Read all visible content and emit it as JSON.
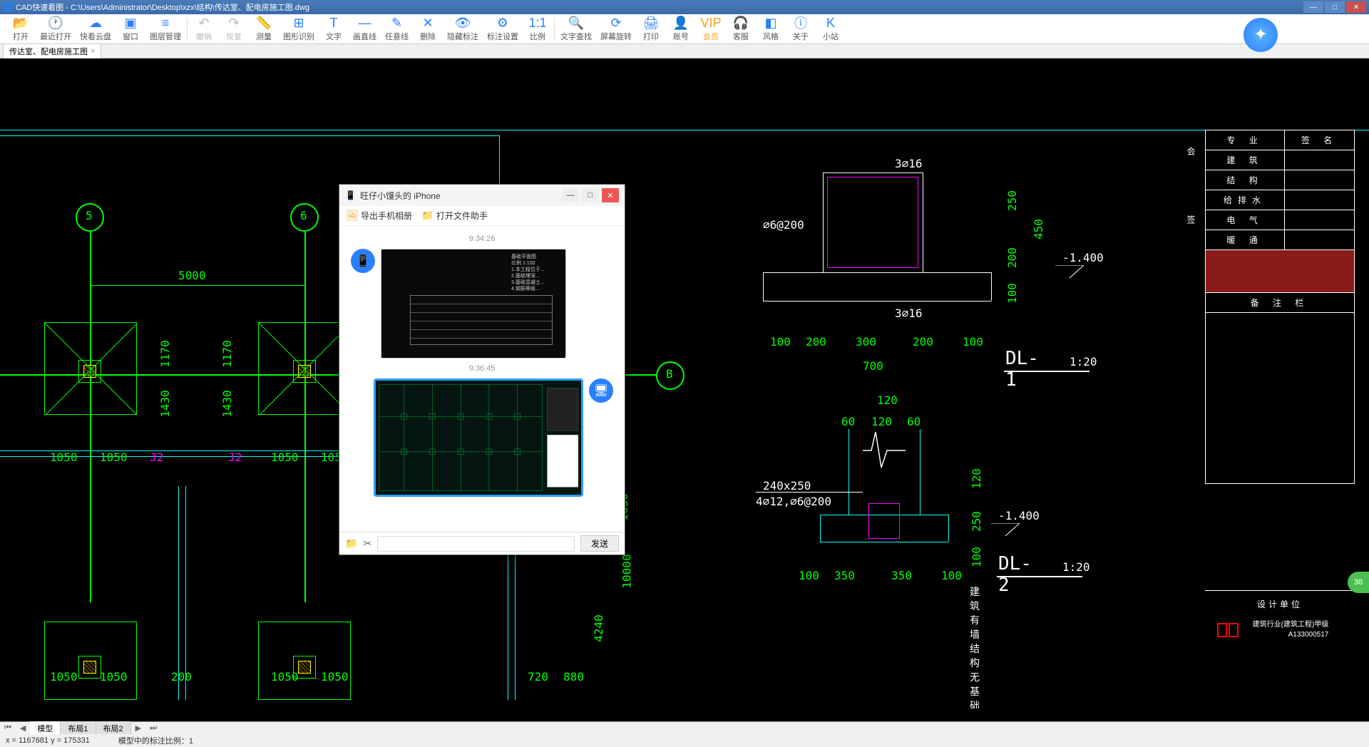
{
  "titlebar": {
    "app_name": "CAD快速看图",
    "file_path": "C:\\Users\\Administrator\\Desktop\\xzx\\结构\\传达室、配电房施工图.dwg"
  },
  "toolbar": [
    {
      "icon": "📂",
      "label": "打开",
      "name": "open-button"
    },
    {
      "icon": "🕐",
      "label": "最近打开",
      "name": "recent-button"
    },
    {
      "icon": "☁",
      "label": "快看云盘",
      "name": "cloud-button"
    },
    {
      "icon": "▣",
      "label": "窗口",
      "name": "window-button"
    },
    {
      "icon": "≡",
      "label": "图层管理",
      "name": "layer-button"
    },
    {
      "sep": true
    },
    {
      "icon": "↶",
      "label": "撤销",
      "name": "undo-button",
      "disabled": true
    },
    {
      "icon": "↷",
      "label": "恢复",
      "name": "redo-button",
      "disabled": true
    },
    {
      "icon": "📏",
      "label": "测量",
      "name": "measure-button"
    },
    {
      "icon": "⊞",
      "label": "图形识别",
      "name": "recognize-button"
    },
    {
      "icon": "T",
      "label": "文字",
      "name": "text-button"
    },
    {
      "icon": "—",
      "label": "画直线",
      "name": "line-button"
    },
    {
      "icon": "✎",
      "label": "任意线",
      "name": "freeline-button"
    },
    {
      "icon": "✕",
      "label": "删除",
      "name": "delete-button"
    },
    {
      "icon": "👁",
      "label": "隐藏标注",
      "name": "hide-annot-button"
    },
    {
      "icon": "⚙",
      "label": "标注设置",
      "name": "annot-settings-button"
    },
    {
      "icon": "1:1",
      "label": "比例",
      "name": "scale-button"
    },
    {
      "sep": true
    },
    {
      "icon": "🔍",
      "label": "文字查找",
      "name": "find-text-button"
    },
    {
      "icon": "⟳",
      "label": "屏幕旋转",
      "name": "rotate-button"
    },
    {
      "icon": "🖨",
      "label": "打印",
      "name": "print-button"
    },
    {
      "icon": "👤",
      "label": "账号",
      "name": "account-button"
    },
    {
      "icon": "VIP",
      "label": "会员",
      "name": "vip-button",
      "vip": true
    },
    {
      "icon": "🎧",
      "label": "客服",
      "name": "support-button"
    },
    {
      "icon": "◧",
      "label": "风格",
      "name": "style-button"
    },
    {
      "icon": "ⓘ",
      "label": "关于",
      "name": "about-button"
    },
    {
      "icon": "K",
      "label": "小站",
      "name": "station-button"
    }
  ],
  "tab": {
    "name": "传达室、配电房施工图"
  },
  "bottom_tabs": {
    "model": "模型",
    "layout1": "布局1",
    "layout2": "布局2"
  },
  "status": {
    "coords": "x = 1167681  y = 175331",
    "scale_info": "模型中的标注比例：1"
  },
  "info_panel": {
    "rows": [
      [
        "专 业",
        "签 名"
      ],
      [
        "建 筑",
        ""
      ],
      [
        "结 构",
        ""
      ],
      [
        "给排水",
        ""
      ],
      [
        "电 气",
        ""
      ],
      [
        "暖 通",
        ""
      ]
    ],
    "remark_label": "备 注 栏",
    "vert1": "会",
    "vert2": "签"
  },
  "design_unit": {
    "title": "设计单位",
    "line1": "建筑行业(建筑工程)甲级",
    "line2": "A133000517"
  },
  "cad_labels": {
    "g5": "5",
    "g6": "6",
    "gB": "B",
    "d5000": "5000",
    "d1170a": "1170",
    "d1430a": "1430",
    "d1170b": "1170",
    "d1430b": "1430",
    "d1050_1": "1050",
    "d1050_2": "1050",
    "d1050_3": "1050",
    "d1050_4": "1050",
    "d1050_5": "1050",
    "d1050_6": "1050",
    "d1050_7": "1050",
    "d1050_8": "1050",
    "d200": "200",
    "d4240": "4240",
    "d10000": "10000",
    "d1630": "1630",
    "d720": "720",
    "d880": "880",
    "J2a": "J2",
    "J2b": "J2",
    "DL2": "DL-2",
    "s1_3f16t": "3⌀16",
    "s1_3f16b": "3⌀16",
    "s1_f6_200": "⌀6@200",
    "s1_250": "250",
    "s1_450": "450",
    "s1_200": "200",
    "s1_100l": "100",
    "s1_100r": "100",
    "s1_100a": "100",
    "s1_200a": "200",
    "s1_300": "300",
    "s1_200b": "200",
    "s1_100b": "100",
    "s1_700": "700",
    "s1_name": "DL-1",
    "s1_scale": "1:20",
    "s1_lvl": "-1.400",
    "s2_120t": "120",
    "s2_60l": "60",
    "s2_120m": "120",
    "s2_60r": "60",
    "s2_240x250": "240x250",
    "s2_rebar": "4⌀12,⌀6@200",
    "s2_120v": "120",
    "s2_250": "250",
    "s2_100v": "100",
    "s2_100l": "100",
    "s2_350a": "350",
    "s2_350b": "350",
    "s2_100r": "100",
    "s2_name": "DL-2",
    "s2_scale": "1:20",
    "s2_lvl": "-1.400",
    "s2_note": "建筑有墙结构无基础处设"
  },
  "chat": {
    "title": "旺仔小馒头的 iPhone",
    "export_photo": "导出手机相册",
    "open_file_helper": "打开文件助手",
    "time1": "9:34:26",
    "time2": "9:36:45",
    "send": "发送"
  },
  "badge": "38"
}
